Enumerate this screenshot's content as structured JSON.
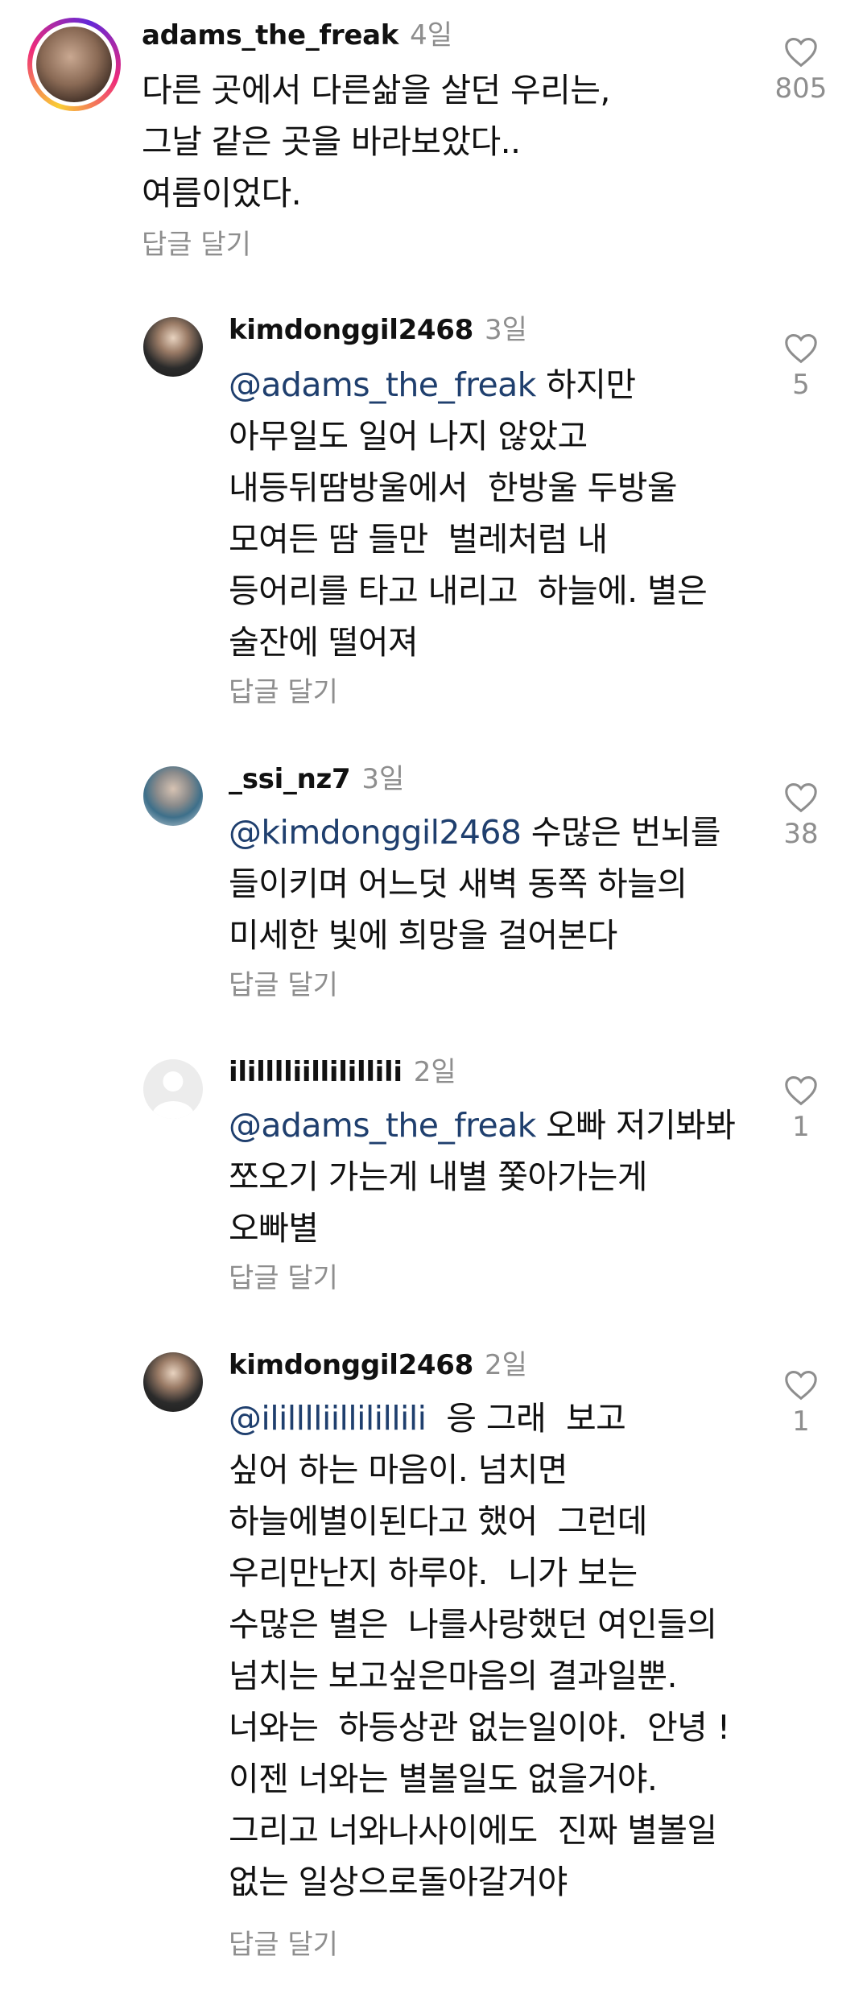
{
  "comments": [
    {
      "username": "adams_the_freak",
      "time": "4일",
      "mention": "",
      "lines": [
        "다른 곳에서 다른삶을 살던 우리는,",
        "그날 같은 곳을 바라보았다..",
        "여름이었다."
      ],
      "reply_label": "답글 달기",
      "likes": "805",
      "avatar": "story-ring-avatar"
    },
    {
      "username": "kimdonggil2468",
      "time": "3일",
      "mention": "@adams_the_freak",
      "first_line_rest": " 하지만",
      "lines": [
        "아무일도 일어 나지 않았고",
        "내등뒤땀방울에서  한방울 두방울",
        "모여든 땀 들만  벌레처럼 내",
        "등어리를 타고 내리고  하늘에. 별은",
        "술잔에 떨어져"
      ],
      "reply_label": "답글 달기",
      "likes": "5",
      "avatar": "photo-avatar"
    },
    {
      "username": "_ssi_nz7",
      "time": "3일",
      "mention": "@kimdonggil2468",
      "first_line_rest": " 수많은 번뇌를",
      "lines": [
        "들이키며 어느덧 새벽 동쪽 하늘의",
        "미세한 빛에 희망을 걸어본다"
      ],
      "reply_label": "답글 달기",
      "likes": "38",
      "avatar": "photo-avatar-2"
    },
    {
      "username": "ililllliillilillili",
      "time": "2일",
      "mention": "@adams_the_freak",
      "first_line_rest": " 오빠 저기봐봐",
      "lines": [
        "쪼오기 가는게 내별 쫓아가는게",
        "오빠별"
      ],
      "reply_label": "답글 달기",
      "likes": "1",
      "avatar": "default-avatar"
    },
    {
      "username": "kimdonggil2468",
      "time": "2일",
      "mention": "@ililllliillilillili",
      "first_line_rest": "  응 그래  보고",
      "lines": [
        "싶어 하는 마음이. 넘치면",
        "하늘에별이된다고 했어  그런데",
        "우리만난지 하루야.  니가 보는",
        "수많은 별은  나를사랑했던 여인들의",
        "넘치는 보고싶은마음의 결과일뿐.",
        "너와는  하등상관 없는일이야.  안녕 !",
        "이젠 너와는 별볼일도 없을거야.",
        "그리고 너와나사이에도  진짜 별볼일",
        "없는 일상으로돌아갈거야"
      ],
      "reply_label": "답글 달기",
      "likes": "1",
      "avatar": "photo-avatar"
    }
  ],
  "icons": {
    "like": "heart-outline-icon"
  }
}
